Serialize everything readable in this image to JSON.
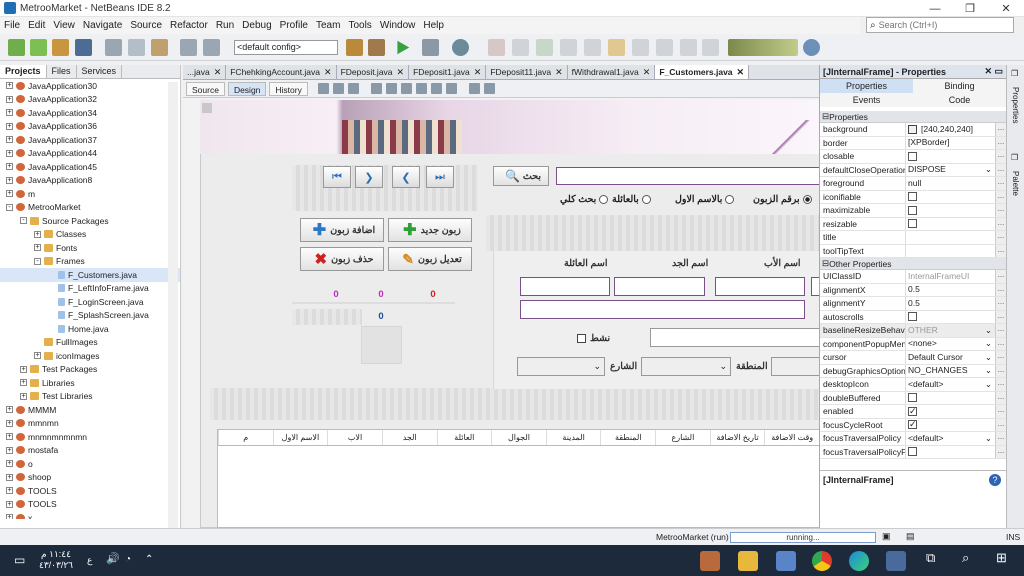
{
  "window": {
    "title": "MetrooMarket - NetBeans IDE 8.2"
  },
  "menu": [
    "File",
    "Edit",
    "View",
    "Navigate",
    "Source",
    "Refactor",
    "Run",
    "Debug",
    "Profile",
    "Team",
    "Tools",
    "Window",
    "Help"
  ],
  "search": {
    "placeholder": "Search (Ctrl+I)"
  },
  "toolbar": {
    "config": "<default config>"
  },
  "projects_panel": {
    "tabs": [
      "Projects",
      "Files",
      "Services"
    ],
    "tree": [
      {
        "label": "JavaApplication30",
        "depth": 0,
        "kind": "cup",
        "toggle": "+"
      },
      {
        "label": "JavaApplication32",
        "depth": 0,
        "kind": "cup",
        "toggle": "+"
      },
      {
        "label": "JavaApplication34",
        "depth": 0,
        "kind": "cup",
        "toggle": "+"
      },
      {
        "label": "JavaApplication36",
        "depth": 0,
        "kind": "cup",
        "toggle": "+"
      },
      {
        "label": "JavaApplication37",
        "depth": 0,
        "kind": "cup",
        "toggle": "+"
      },
      {
        "label": "JavaApplication44",
        "depth": 0,
        "kind": "cup",
        "toggle": "+"
      },
      {
        "label": "JavaApplication45",
        "depth": 0,
        "kind": "cup",
        "toggle": "+"
      },
      {
        "label": "JavaApplication8",
        "depth": 0,
        "kind": "cup",
        "toggle": "+"
      },
      {
        "label": "m",
        "depth": 0,
        "kind": "cup",
        "toggle": "+"
      },
      {
        "label": "MetrooMarket",
        "depth": 0,
        "kind": "cup",
        "toggle": "-"
      },
      {
        "label": "Source Packages",
        "depth": 1,
        "kind": "fold",
        "toggle": "-"
      },
      {
        "label": "Classes",
        "depth": 2,
        "kind": "fold",
        "toggle": "+"
      },
      {
        "label": "Fonts",
        "depth": 2,
        "kind": "fold",
        "toggle": "+"
      },
      {
        "label": "Frames",
        "depth": 2,
        "kind": "fold",
        "toggle": "-"
      },
      {
        "label": "F_Customers.java",
        "depth": 3,
        "kind": "file",
        "toggle": ""
      },
      {
        "label": "F_LeftInfoFrame.java",
        "depth": 3,
        "kind": "file",
        "toggle": ""
      },
      {
        "label": "F_LoginScreen.java",
        "depth": 3,
        "kind": "file",
        "toggle": ""
      },
      {
        "label": "F_SplashScreen.java",
        "depth": 3,
        "kind": "file",
        "toggle": ""
      },
      {
        "label": "Home.java",
        "depth": 3,
        "kind": "file",
        "toggle": ""
      },
      {
        "label": "FullImages",
        "depth": 2,
        "kind": "fold",
        "toggle": ""
      },
      {
        "label": "iconImages",
        "depth": 2,
        "kind": "fold",
        "toggle": "+"
      },
      {
        "label": "Test Packages",
        "depth": 1,
        "kind": "fold",
        "toggle": "+"
      },
      {
        "label": "Libraries",
        "depth": 1,
        "kind": "fold",
        "toggle": "+"
      },
      {
        "label": "Test Libraries",
        "depth": 1,
        "kind": "fold",
        "toggle": "+"
      },
      {
        "label": "MMMM",
        "depth": 0,
        "kind": "cup",
        "toggle": "+"
      },
      {
        "label": "mmnmn",
        "depth": 0,
        "kind": "cup",
        "toggle": "+"
      },
      {
        "label": "mnmnmnmnmn",
        "depth": 0,
        "kind": "cup",
        "toggle": "+"
      },
      {
        "label": "mostafa",
        "depth": 0,
        "kind": "cup",
        "toggle": "+"
      },
      {
        "label": "o",
        "depth": 0,
        "kind": "cup",
        "toggle": "+"
      },
      {
        "label": "shoop",
        "depth": 0,
        "kind": "cup",
        "toggle": "+"
      },
      {
        "label": "TOOLS",
        "depth": 0,
        "kind": "cup",
        "toggle": "+"
      },
      {
        "label": "TOOLS",
        "depth": 0,
        "kind": "cup",
        "toggle": "+"
      },
      {
        "label": "x",
        "depth": 0,
        "kind": "cup",
        "toggle": "+"
      }
    ]
  },
  "editor": {
    "tabs": [
      {
        "label": "...java",
        "active": false
      },
      {
        "label": "FChehkingAccount.java",
        "active": false
      },
      {
        "label": "FDeposit.java",
        "active": false
      },
      {
        "label": "FDeposit1.java",
        "active": false
      },
      {
        "label": "FDeposit11.java",
        "active": false
      },
      {
        "label": "fWithdrawal1.java",
        "active": false
      },
      {
        "label": "F_Customers.java",
        "active": true
      }
    ],
    "view_tabs": [
      "Source",
      "Design",
      "History"
    ]
  },
  "form": {
    "search_button": "بحث",
    "radios": [
      {
        "label": "برقم الزبون",
        "checked": true
      },
      {
        "label": "بالاسم الاول",
        "checked": false
      },
      {
        "label": "بالعائلة",
        "checked": false
      },
      {
        "label": "بحث كلي",
        "checked": false
      }
    ],
    "buttons": {
      "new_customer": "زبون جديد",
      "add_customer": "اضافة زبون",
      "edit_customer": "تعديل زبون",
      "delete_customer": "حذف زبون"
    },
    "counters": [
      "0",
      "0",
      "0",
      "0"
    ],
    "labels": {
      "father": "اسم الأب",
      "grandfather": "اسم الجد",
      "family": "اسم العائلة",
      "active": "نشط",
      "region": "المنطقة",
      "street": "الشارع"
    },
    "table_columns": [
      "وقت الاضافة",
      "تاريخ الاضافة",
      "الشارع",
      "المنطقة",
      "المدينة",
      "الجوال",
      "العائلة",
      "الجد",
      "الاب",
      "الاسم الاول",
      "م"
    ]
  },
  "properties_panel": {
    "title": "[JInternalFrame] - Properties",
    "tabs": [
      "Properties",
      "Binding",
      "Events",
      "Code"
    ],
    "section1": "Properties",
    "props1": [
      {
        "k": "background",
        "v": "[240,240,240]",
        "t": "color"
      },
      {
        "k": "border",
        "v": "[XPBorder]",
        "t": "text"
      },
      {
        "k": "closable",
        "v": "",
        "t": "check"
      },
      {
        "k": "defaultCloseOperation",
        "v": "DISPOSE",
        "t": "combo"
      },
      {
        "k": "foreground",
        "v": "null",
        "t": "text"
      },
      {
        "k": "iconifiable",
        "v": "",
        "t": "check"
      },
      {
        "k": "maximizable",
        "v": "",
        "t": "check"
      },
      {
        "k": "resizable",
        "v": "",
        "t": "check"
      },
      {
        "k": "title",
        "v": "",
        "t": "text"
      },
      {
        "k": "toolTipText",
        "v": "",
        "t": "text"
      }
    ],
    "section2": "Other Properties",
    "props2": [
      {
        "k": "UIClassID",
        "v": "InternalFrameUI",
        "t": "gray"
      },
      {
        "k": "alignmentX",
        "v": "0.5",
        "t": "text"
      },
      {
        "k": "alignmentY",
        "v": "0.5",
        "t": "text"
      },
      {
        "k": "autoscrolls",
        "v": "",
        "t": "check"
      },
      {
        "k": "baselineResizeBehavio",
        "v": "OTHER",
        "t": "graycombo"
      },
      {
        "k": "componentPopupMenu",
        "v": "<none>",
        "t": "combo"
      },
      {
        "k": "cursor",
        "v": "Default Cursor",
        "t": "combo"
      },
      {
        "k": "debugGraphicsOptions",
        "v": "NO_CHANGES",
        "t": "combo"
      },
      {
        "k": "desktopIcon",
        "v": "<default>",
        "t": "combo"
      },
      {
        "k": "doubleBuffered",
        "v": "",
        "t": "check"
      },
      {
        "k": "enabled",
        "v": "on",
        "t": "check"
      },
      {
        "k": "focusCycleRoot",
        "v": "on",
        "t": "check"
      },
      {
        "k": "focusTraversalPolicy",
        "v": "<default>",
        "t": "combo"
      },
      {
        "k": "focusTraversalPolicyPr",
        "v": "",
        "t": "check"
      }
    ],
    "footer": "[JInternalFrame]"
  },
  "side_tabs": [
    "Properties",
    "Palette"
  ],
  "status": {
    "project": "MetrooMarket (run)",
    "progress": "running...",
    "mode": "INS"
  },
  "taskbar": {
    "time": "١١:٤٤ م",
    "date": "٤٣/٠٣/٢٦",
    "lang": "ع"
  }
}
